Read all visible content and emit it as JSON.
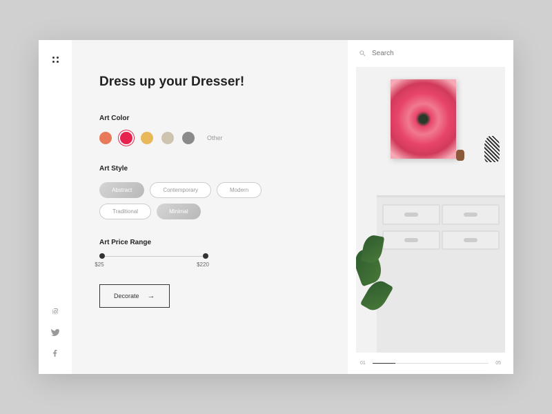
{
  "header": {
    "title": "Dress up your Dresser!"
  },
  "search": {
    "placeholder": "Search"
  },
  "sections": {
    "color": {
      "label": "Art Color",
      "other": "Other",
      "swatches": [
        "#e87a5a",
        "#e6234f",
        "#e8b85a",
        "#cfc4af",
        "#8a8a8a"
      ],
      "selected_index": 1
    },
    "style": {
      "label": "Art Style",
      "options": [
        "Abstract",
        "Contemporary",
        "Modern",
        "Traditional",
        "Minimal"
      ],
      "selected": [
        0,
        4
      ]
    },
    "price": {
      "label": "Art Price Range",
      "min": "$25",
      "max": "$220"
    }
  },
  "cta": {
    "label": "Decorate"
  },
  "pagination": {
    "current": "01",
    "total": "05"
  }
}
